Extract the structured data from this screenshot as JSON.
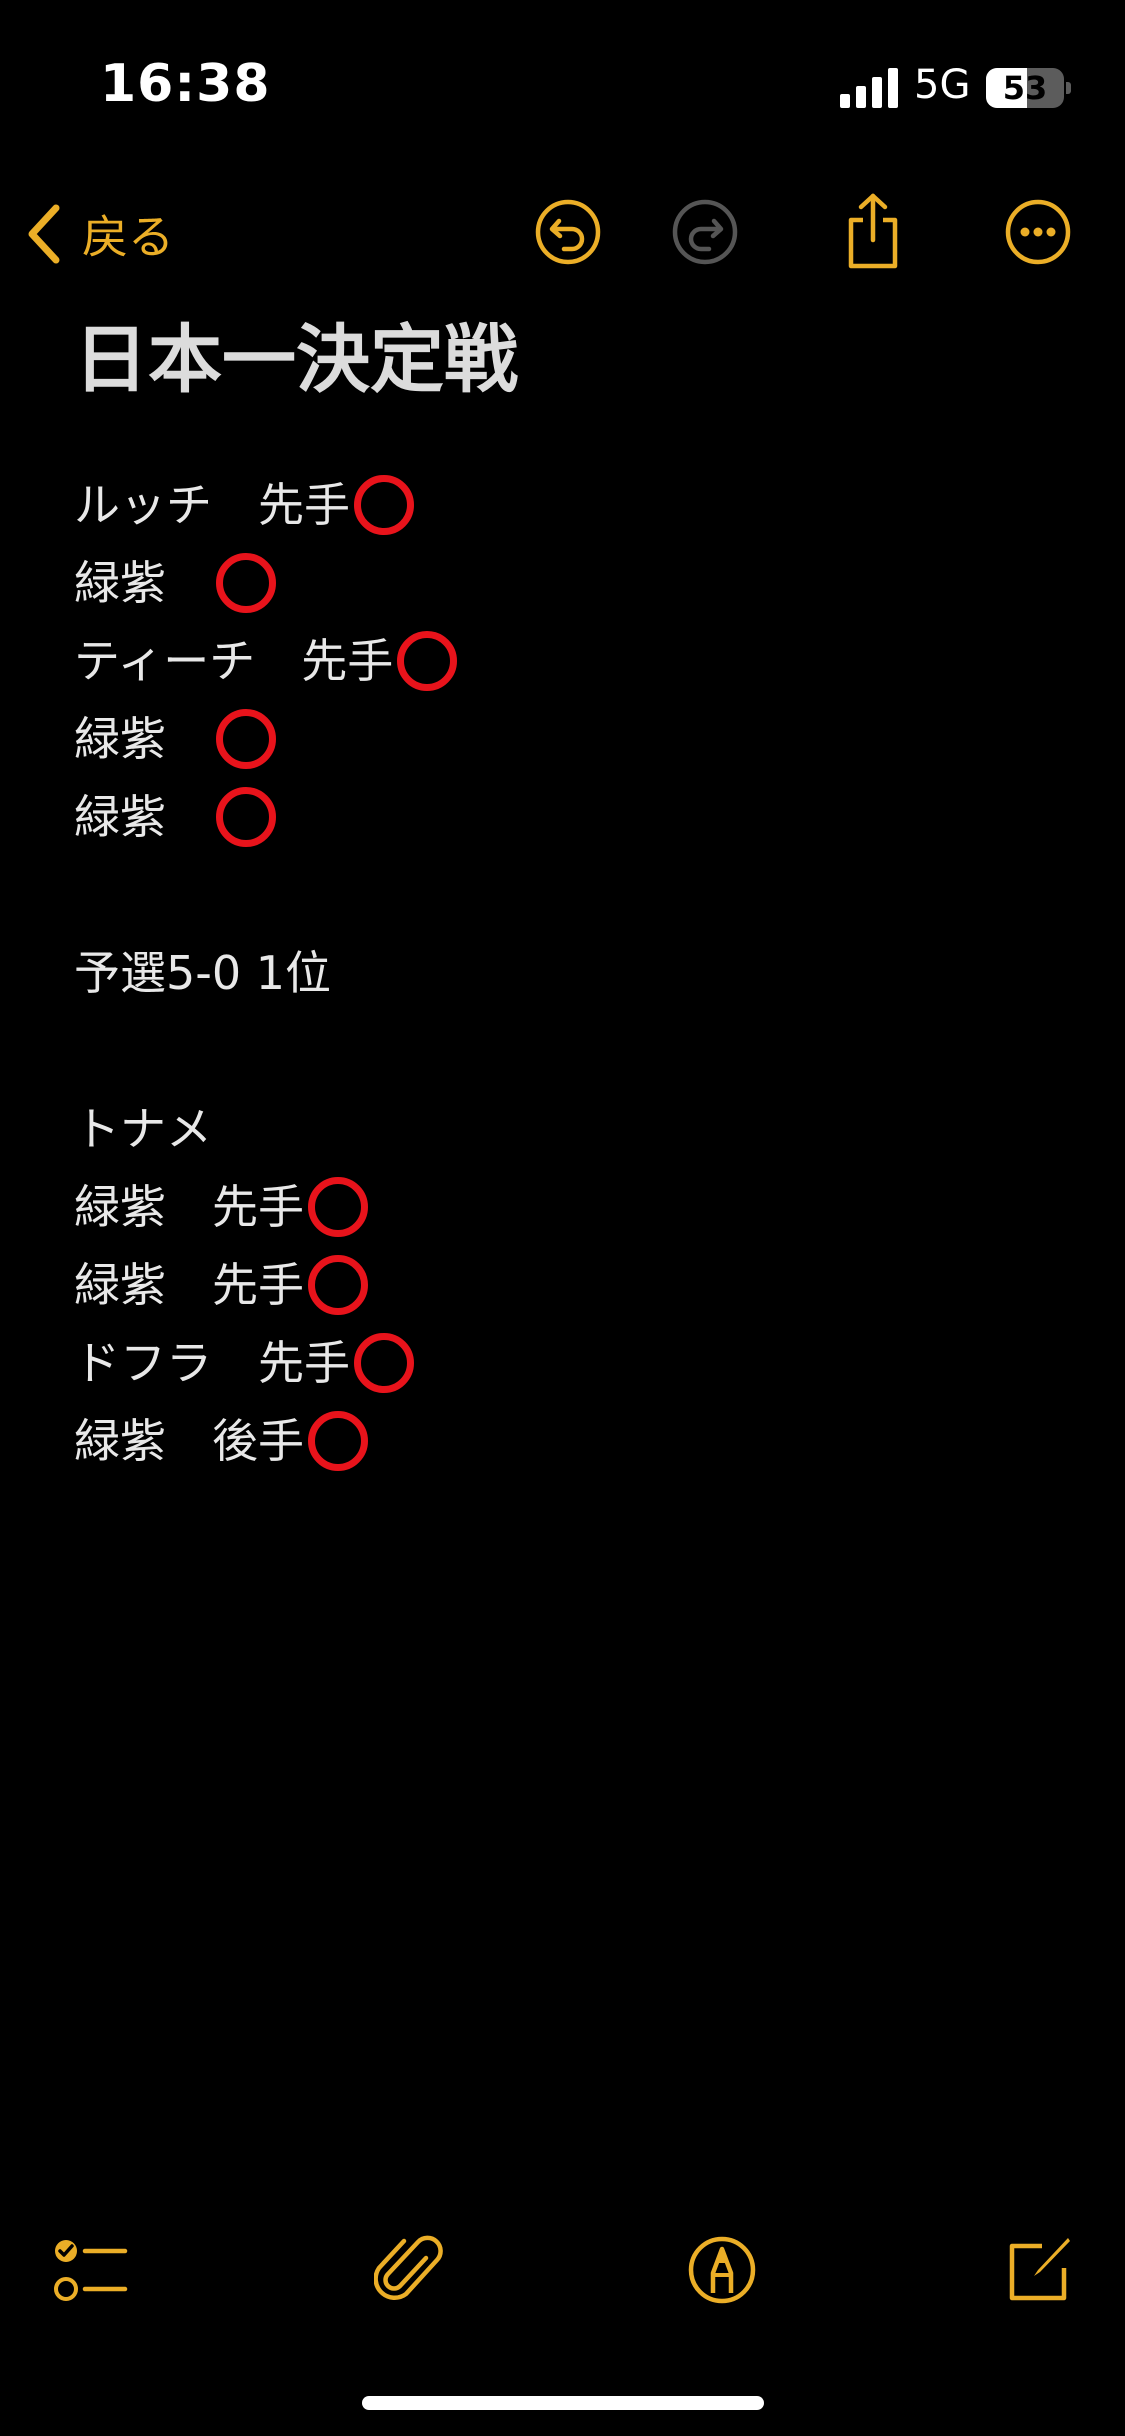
{
  "status_bar": {
    "time": "16:38",
    "network": "5G",
    "battery_percent": "53",
    "battery_level": 0.53
  },
  "nav": {
    "back_label": "戻る",
    "accent_color": "#ebae27",
    "buttons": [
      "undo-icon",
      "redo-icon",
      "share-icon",
      "more-icon"
    ]
  },
  "note": {
    "title": "日本一決定戦",
    "lines": [
      {
        "text": "ルッチ　先手",
        "mark": "⭕"
      },
      {
        "text": "緑紫　",
        "mark": "⭕"
      },
      {
        "text": "ティーチ　先手",
        "mark": "⭕"
      },
      {
        "text": "緑紫　",
        "mark": "⭕"
      },
      {
        "text": "緑紫　",
        "mark": "⭕"
      },
      {
        "text": "",
        "mark": ""
      },
      {
        "text": "予選5-0 1位",
        "mark": ""
      },
      {
        "text": "",
        "mark": ""
      },
      {
        "text": "トナメ",
        "mark": ""
      },
      {
        "text": "緑紫　先手",
        "mark": "⭕"
      },
      {
        "text": "緑紫　先手",
        "mark": "⭕"
      },
      {
        "text": "ドフラ　先手",
        "mark": "⭕"
      },
      {
        "text": "緑紫　後手",
        "mark": "⭕"
      }
    ]
  },
  "toolbar": {
    "items": [
      "checklist-icon",
      "attachment-icon",
      "markup-icon",
      "compose-icon"
    ]
  }
}
